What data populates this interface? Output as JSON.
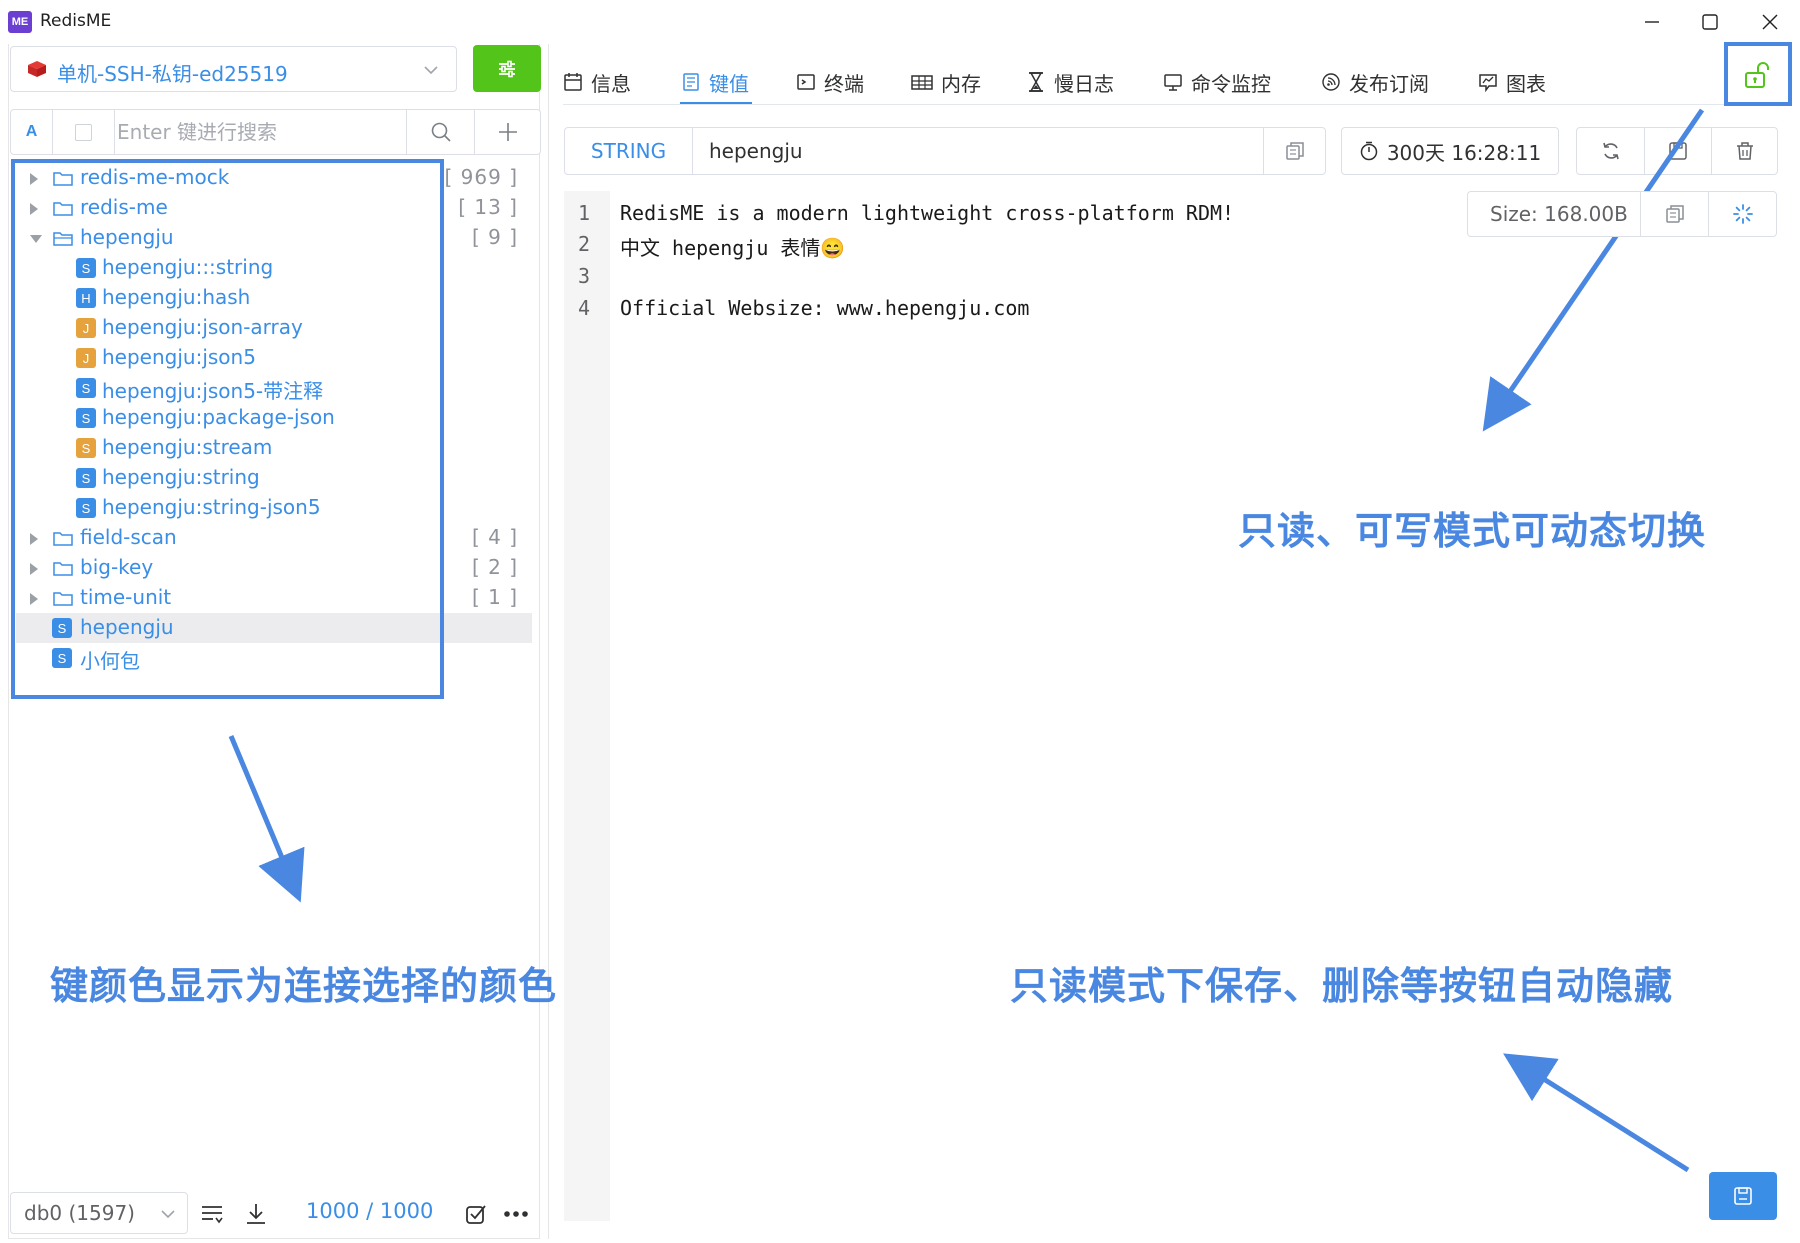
{
  "window": {
    "logo_text": "ME",
    "title": "RedisME"
  },
  "connection": {
    "name": "单机-SSH-私钥-ed25519",
    "icon": "redis-cube-icon"
  },
  "search": {
    "case_label": "A",
    "placeholder": "Enter 键进行搜索"
  },
  "tree": {
    "folders_top": [
      {
        "name": "redis-me-mock",
        "count": "[ 969 ]",
        "expanded": false
      },
      {
        "name": "redis-me",
        "count": "[ 13 ]",
        "expanded": false
      },
      {
        "name": "hepengju",
        "count": "[ 9 ]",
        "expanded": true
      }
    ],
    "children": [
      {
        "type": "S",
        "name": "hepengju:::string",
        "color": "#3a8ee6"
      },
      {
        "type": "H",
        "name": "hepengju:hash",
        "color": "#3a8ee6"
      },
      {
        "type": "J",
        "name": "hepengju:json-array",
        "color": "#e6a23c"
      },
      {
        "type": "J",
        "name": "hepengju:json5",
        "color": "#e6a23c"
      },
      {
        "type": "S",
        "name": "hepengju:json5-带注释",
        "color": "#3a8ee6"
      },
      {
        "type": "S",
        "name": "hepengju:package-json",
        "color": "#3a8ee6"
      },
      {
        "type": "S",
        "name": "hepengju:stream",
        "color": "#e6a23c"
      },
      {
        "type": "S",
        "name": "hepengju:string",
        "color": "#3a8ee6"
      },
      {
        "type": "S",
        "name": "hepengju:string-json5",
        "color": "#3a8ee6"
      }
    ],
    "folders_bottom": [
      {
        "name": "field-scan",
        "count": "[ 4 ]"
      },
      {
        "name": "big-key",
        "count": "[ 2 ]"
      },
      {
        "name": "time-unit",
        "count": "[ 1 ]"
      }
    ],
    "top_keys": [
      {
        "type": "S",
        "name": "hepengju",
        "selected": true
      },
      {
        "type": "S",
        "name": "小何包",
        "selected": false
      }
    ]
  },
  "footer": {
    "db": "db0 (1597)",
    "loaded": "1000",
    "separator": " / ",
    "total": "1000"
  },
  "tabs": [
    {
      "label": "信息",
      "icon": "calendar-icon",
      "active": false
    },
    {
      "label": "键值",
      "icon": "document-icon",
      "active": true
    },
    {
      "label": "终端",
      "icon": "terminal-icon",
      "active": false
    },
    {
      "label": "内存",
      "icon": "table-icon",
      "active": false
    },
    {
      "label": "慢日志",
      "icon": "hourglass-icon",
      "active": false
    },
    {
      "label": "命令监控",
      "icon": "monitor-icon",
      "active": false
    },
    {
      "label": "发布订阅",
      "icon": "broadcast-icon",
      "active": false
    },
    {
      "label": "图表",
      "icon": "chart-icon",
      "active": false
    }
  ],
  "key_detail": {
    "type": "STRING",
    "name": "hepengju",
    "ttl": "300天 16:28:11",
    "size": "Size: 168.00B"
  },
  "editor": {
    "lines": [
      {
        "no": "1",
        "text": "RedisME is a modern lightweight cross-platform RDM!"
      },
      {
        "no": "2",
        "text": "中文 hepengju 表情😄"
      },
      {
        "no": "3",
        "text": ""
      },
      {
        "no": "4",
        "text": "Official Websize: www.hepengju.com"
      }
    ]
  },
  "annotations": {
    "toggle_mode": "只读、可写模式可动态切换",
    "key_color": "键颜色显示为连接选择的颜色",
    "readonly_hide": "只读模式下保存、删除等按钮自动隐藏"
  },
  "colors": {
    "accent": "#3a8ee6",
    "success": "#52c41a",
    "annotation": "#4a87e0",
    "json_badge": "#e6a23c"
  }
}
